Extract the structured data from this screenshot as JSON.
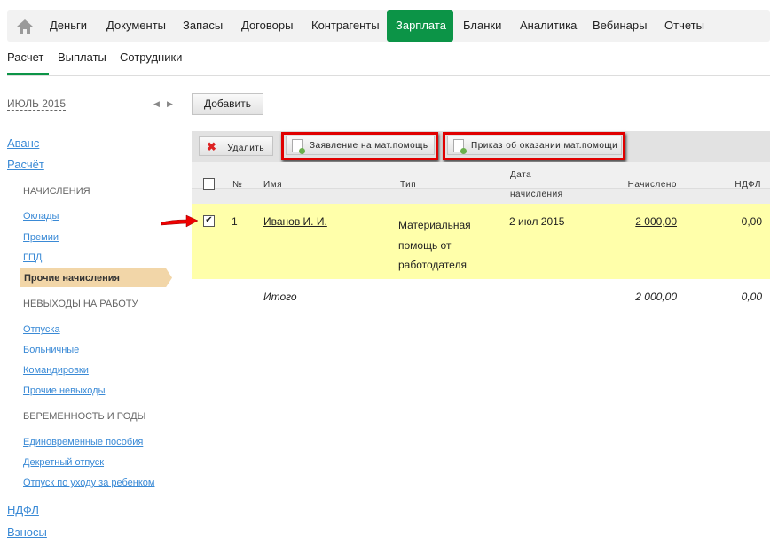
{
  "topnav": {
    "items": [
      "Деньги",
      "Документы",
      "Запасы",
      "Договоры",
      "Контрагенты",
      "Зарплата",
      "Бланки",
      "Аналитика",
      "Вебинары",
      "Отчеты"
    ],
    "active": "Зарплата"
  },
  "subnav": {
    "items": [
      "Расчет",
      "Выплаты",
      "Сотрудники"
    ],
    "active": "Расчет"
  },
  "period": {
    "label": "ИЮЛЬ 2015"
  },
  "sidebar": {
    "avans": "Аванс",
    "raschet": "Расчёт",
    "h1": "НАЧИСЛЕНИЯ",
    "oklady": "Оклады",
    "premii": "Премии",
    "gpd": "ГПД",
    "prochie": "Прочие начисления",
    "h2": "НЕВЫХОДЫ НА РАБОТУ",
    "otpuska": "Отпуска",
    "bolnichnye": "Больничные",
    "komandirovki": "Командировки",
    "prochie_nev": "Прочие невыходы",
    "h3": "БЕРЕМЕННОСТЬ И РОДЫ",
    "edinovr": "Единовременные пособия",
    "dekret": "Декретный отпуск",
    "uhod": "Отпуск по уходу за ребенком",
    "ndfl": "НДФЛ",
    "vznosy": "Взносы"
  },
  "toolbar": {
    "add": "Добавить",
    "delete": "Удалить",
    "zayavlenie": "Заявление на мат.помощь",
    "prikaz": "Приказ об оказании мат.помощи"
  },
  "table": {
    "headers": {
      "num": "№",
      "name": "Имя",
      "type": "Тип",
      "date1": "Дата",
      "date2": "начисления",
      "accrued": "Начислено",
      "ndfl": "НДФЛ"
    },
    "rows": [
      {
        "num": "1",
        "name": "Иванов И. И.",
        "type": [
          "Материальная",
          "помощь от",
          "работодателя"
        ],
        "date": "2 июл 2015",
        "accrued": "2 000,00",
        "ndfl": "0,00",
        "checked": true
      }
    ],
    "total": {
      "label": "Итого",
      "accrued": "2 000,00",
      "ndfl": "0,00"
    }
  }
}
